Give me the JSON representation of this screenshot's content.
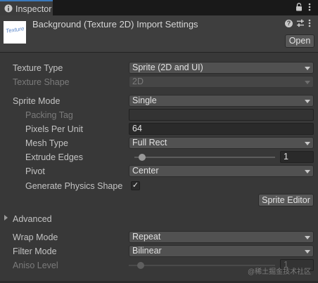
{
  "tab": {
    "title": "Inspector",
    "icon": "info-icon"
  },
  "header": {
    "title": "Background (Texture 2D) Import Settings",
    "thumbnail_text": "Texture",
    "open_button": "Open",
    "help_icon_glyph": "?"
  },
  "fields": {
    "texture_type": {
      "label": "Texture Type",
      "value": "Sprite (2D and UI)"
    },
    "texture_shape": {
      "label": "Texture Shape",
      "value": "2D"
    },
    "sprite_mode": {
      "label": "Sprite Mode",
      "value": "Single"
    },
    "packing_tag": {
      "label": "Packing Tag",
      "value": ""
    },
    "pixels_per_unit": {
      "label": "Pixels Per Unit",
      "value": "64"
    },
    "mesh_type": {
      "label": "Mesh Type",
      "value": "Full Rect"
    },
    "extrude_edges": {
      "label": "Extrude Edges",
      "value": "1",
      "slider_fraction": 0.03
    },
    "pivot": {
      "label": "Pivot",
      "value": "Center"
    },
    "generate_physics_shape": {
      "label": "Generate Physics Shape",
      "checked": true,
      "glyph": "✓"
    }
  },
  "sprite_editor_button": "Sprite Editor",
  "advanced": {
    "label": "Advanced",
    "expanded": false
  },
  "wrap_mode": {
    "label": "Wrap Mode",
    "value": "Repeat"
  },
  "filter_mode": {
    "label": "Filter Mode",
    "value": "Bilinear"
  },
  "aniso_level": {
    "label": "Aniso Level",
    "value": "1",
    "slider_fraction": 0.06
  },
  "watermark": "@稀土掘金技术社区",
  "colors": {
    "accent": "#3a79bb",
    "background": "#383838",
    "text": "#c4c4c4"
  }
}
